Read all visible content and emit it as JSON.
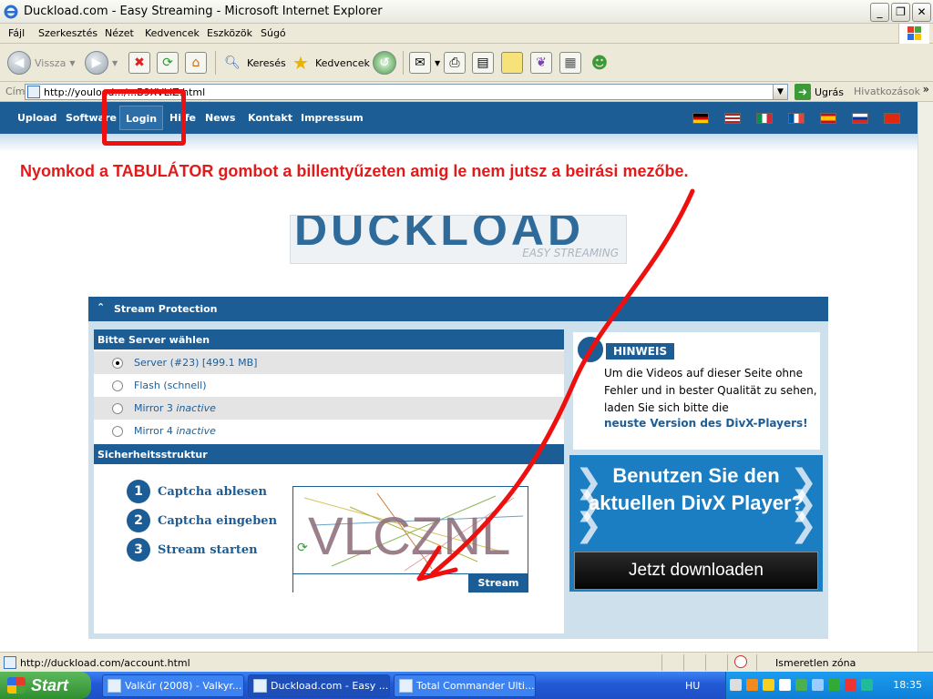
{
  "window": {
    "title": "Duckload.com - Easy Streaming - Microsoft Internet Explorer"
  },
  "menu": [
    "Fájl",
    "Szerkesztés",
    "Nézet",
    "Kedvencek",
    "Eszközök",
    "Súgó"
  ],
  "toolbar": {
    "back_label": "Vissza",
    "search_label": "Keresés",
    "favorites_label": "Kedvencek"
  },
  "address": {
    "label": "Cím",
    "url": "http://youload.../...B9XVLIZ.html",
    "go_label": "Ugrás",
    "links_label": "Hivatkozások"
  },
  "site_nav": {
    "items": [
      "Upload",
      "Software",
      "Login",
      "Hilfe",
      "News",
      "Kontakt",
      "Impressum"
    ],
    "active": "Login",
    "flags": [
      "de",
      "en",
      "it",
      "fr",
      "es",
      "ru",
      "cn"
    ]
  },
  "instruction": "Nyomkod a TABULÁTOR gombot a billentyűzeten amig le nem jutsz a beirási mezőbe.",
  "logo": {
    "text": "DUCKLOAD",
    "tagline": "EASY STREAMING"
  },
  "stream": {
    "header": "Stream Protection",
    "server_heading": "Bitte Server wählen",
    "servers": [
      {
        "label": "Server (#23) [499.1 MB]",
        "status": "",
        "selected": true
      },
      {
        "label": "Flash (schnell)",
        "status": "",
        "selected": false
      },
      {
        "label": "Mirror 3",
        "status": "inactive",
        "selected": false
      },
      {
        "label": "Mirror 4",
        "status": "inactive",
        "selected": false
      }
    ],
    "security_heading": "Sicherheitsstruktur",
    "steps": [
      {
        "num": "1",
        "label": "Captcha ablesen"
      },
      {
        "num": "2",
        "label": "Captcha eingeben"
      },
      {
        "num": "3",
        "label": "Stream starten"
      }
    ],
    "captcha_text": "VLCZNL",
    "captcha_input_value": "",
    "stream_button": "Stream"
  },
  "hinweis": {
    "badge": "HINWEIS",
    "body": "Um die Videos auf dieser Seite ohne Fehler und in bester Qualität zu sehen, laden Sie sich bitte die",
    "link": "neuste Version des DivX-Players!"
  },
  "divx_ad": {
    "headline": "Benutzen Sie den aktuellen DivX Player?",
    "download_button": "Jetzt downloaden"
  },
  "statusbar": {
    "url": "http://duckload.com/account.html",
    "zone": "Ismeretlen zóna"
  },
  "taskbar": {
    "start_label": "Start",
    "tasks": [
      {
        "label": "Valkűr (2008) - Valkyr...",
        "active": false
      },
      {
        "label": "Duckload.com - Easy ...",
        "active": true
      },
      {
        "label": "Total Commander Ulti...",
        "active": false
      }
    ],
    "language": "HU",
    "clock": "18:35"
  },
  "colors": {
    "site_blue": "#1c5d96",
    "annotation_red": "#ee0f0f"
  }
}
